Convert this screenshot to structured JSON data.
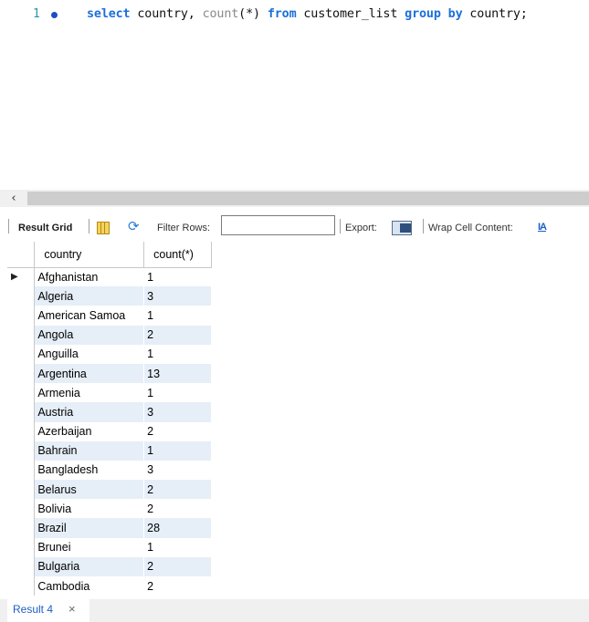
{
  "editor": {
    "line_number": "1",
    "code_tokens": [
      {
        "text": "select",
        "kind": "kw"
      },
      {
        "text": " country, ",
        "kind": "plain"
      },
      {
        "text": "count",
        "kind": "fn"
      },
      {
        "text": "(*) ",
        "kind": "plain"
      },
      {
        "text": "from",
        "kind": "kw"
      },
      {
        "text": " customer_list ",
        "kind": "plain"
      },
      {
        "text": "group",
        "kind": "kw"
      },
      {
        "text": " ",
        "kind": "plain"
      },
      {
        "text": "by",
        "kind": "kw"
      },
      {
        "text": " country;",
        "kind": "plain"
      }
    ]
  },
  "scrollbar": {
    "left_arrow": "‹"
  },
  "toolbar": {
    "result_grid_label": "Result Grid",
    "filter_label": "Filter Rows:",
    "filter_value": "",
    "export_label": "Export:",
    "wrap_label": "Wrap Cell Content:",
    "wrap_icon_text": "IA",
    "icons": [
      "grid-layout-icon",
      "refresh-icon",
      "export-icon",
      "wrap-cell-icon"
    ]
  },
  "grid": {
    "columns": [
      "country",
      "count(*)"
    ],
    "current_row_marker": "▶",
    "rows": [
      [
        "Afghanistan",
        "1"
      ],
      [
        "Algeria",
        "3"
      ],
      [
        "American Samoa",
        "1"
      ],
      [
        "Angola",
        "2"
      ],
      [
        "Anguilla",
        "1"
      ],
      [
        "Argentina",
        "13"
      ],
      [
        "Armenia",
        "1"
      ],
      [
        "Austria",
        "3"
      ],
      [
        "Azerbaijan",
        "2"
      ],
      [
        "Bahrain",
        "1"
      ],
      [
        "Bangladesh",
        "3"
      ],
      [
        "Belarus",
        "2"
      ],
      [
        "Bolivia",
        "2"
      ],
      [
        "Brazil",
        "28"
      ],
      [
        "Brunei",
        "1"
      ],
      [
        "Bulgaria",
        "2"
      ],
      [
        "Cambodia",
        "2"
      ]
    ]
  },
  "tabs": {
    "result_tab_label": "Result 4",
    "close_glyph": "×"
  },
  "colors": {
    "keyword": "#1c6fd9",
    "function": "#8a8a8a",
    "line_number": "#2b91af",
    "row_alt": "#e6eef8"
  }
}
